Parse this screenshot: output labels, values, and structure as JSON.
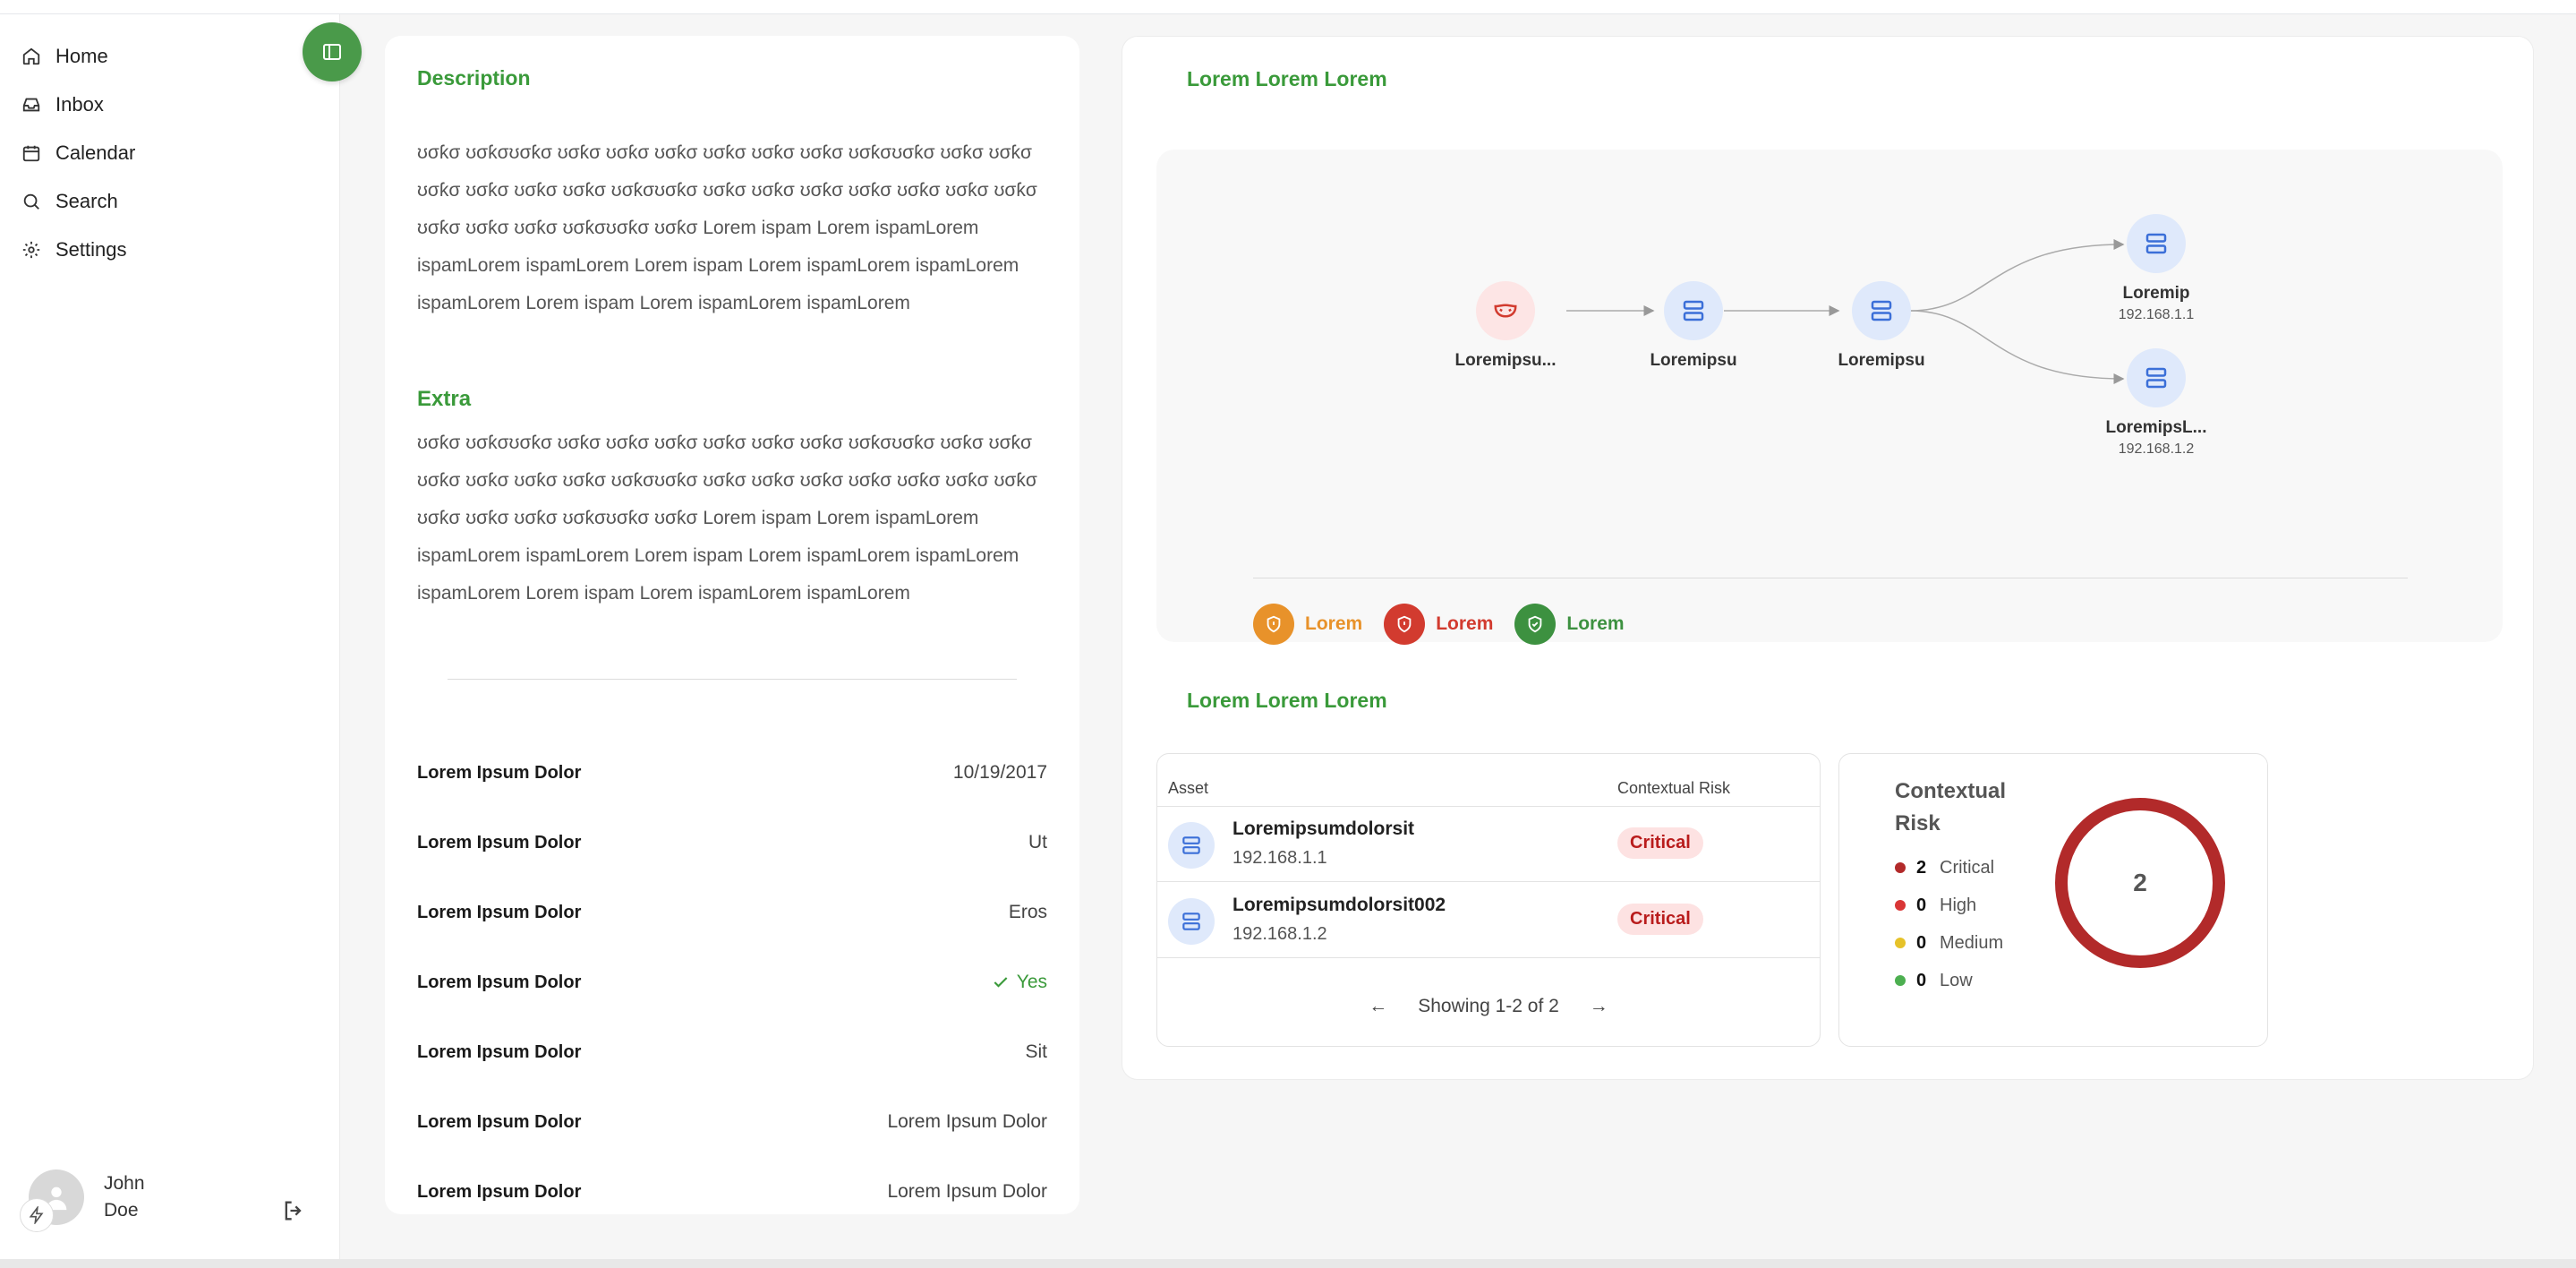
{
  "nav": {
    "items": [
      {
        "label": "Home",
        "icon": "home-icon"
      },
      {
        "label": "Inbox",
        "icon": "inbox-icon"
      },
      {
        "label": "Calendar",
        "icon": "calendar-icon"
      },
      {
        "label": "Search",
        "icon": "search-icon"
      },
      {
        "label": "Settings",
        "icon": "gear-icon"
      }
    ]
  },
  "user": {
    "name": "John Doe"
  },
  "details": {
    "description_title": "Description",
    "description_text": "ʊσƙσ ʊσƙσʊσƙσ ʊσƙσ ʊσƙσ ʊσƙσ ʊσƙσ ʊσƙσ ʊσƙσ ʊσƙσʊσƙσ ʊσƙσ ʊσƙσ ʊσƙσ ʊσƙσ ʊσƙσ ʊσƙσ ʊσƙσʊσƙσ ʊσƙσ ʊσƙσ ʊσƙσ ʊσƙσ ʊσƙσ ʊσƙσ ʊσƙσ ʊσƙσ ʊσƙσ ʊσƙσ ʊσƙσʊσƙσ ʊσƙσ Lorem ispam Lorem ispamLorem ispamLorem ispamLorem Lorem ispam Lorem ispamLorem ispamLorem ispamLorem Lorem ispam Lorem ispamLorem ispamLorem",
    "extra_title": "Extra",
    "extra_text": "ʊσƙσ ʊσƙσʊσƙσ ʊσƙσ ʊσƙσ ʊσƙσ ʊσƙσ ʊσƙσ ʊσƙσ ʊσƙσʊσƙσ ʊσƙσ ʊσƙσ ʊσƙσ ʊσƙσ ʊσƙσ ʊσƙσ ʊσƙσʊσƙσ ʊσƙσ ʊσƙσ ʊσƙσ ʊσƙσ ʊσƙσ ʊσƙσ ʊσƙσ ʊσƙσ ʊσƙσ ʊσƙσ ʊσƙσʊσƙσ ʊσƙσ Lorem ispam Lorem ispamLorem ispamLorem ispamLorem Lorem ispam Lorem ispamLorem ispamLorem ispamLorem Lorem ispam Lorem ispamLorem ispamLorem",
    "props": [
      {
        "key": "Lorem Ipsum Dolor",
        "value": "10/19/2017"
      },
      {
        "key": "Lorem Ipsum Dolor",
        "value": "Ut"
      },
      {
        "key": "Lorem Ipsum Dolor",
        "value": "Eros"
      },
      {
        "key": "Lorem Ipsum Dolor",
        "value": "Yes"
      },
      {
        "key": "Lorem Ipsum Dolor",
        "value": "Sit"
      },
      {
        "key": "Lorem Ipsum Dolor",
        "value": "Lorem Ipsum Dolor"
      },
      {
        "key": "Lorem Ipsum Dolor",
        "value": "Lorem Ipsum Dolor"
      }
    ]
  },
  "graph": {
    "title": "Lorem Lorem Lorem",
    "nodes": [
      {
        "label": "Loremipsu...",
        "ip": ""
      },
      {
        "label": "Loremipsu",
        "ip": ""
      },
      {
        "label": "Loremipsu",
        "ip": ""
      },
      {
        "label": "Loremip",
        "ip": "192.168.1.1"
      },
      {
        "label": "LoremipsL...",
        "ip": "192.168.1.2"
      }
    ],
    "legend": [
      {
        "label": "Lorem",
        "color": "#e8922a"
      },
      {
        "label": "Lorem",
        "color": "#d23b2f"
      },
      {
        "label": "Lorem",
        "color": "#3d9140"
      }
    ]
  },
  "assets": {
    "title": "Lorem Lorem Lorem",
    "headers": {
      "asset": "Asset",
      "risk": "Contextual Risk"
    },
    "rows": [
      {
        "name": "Loremipsumdolorsit",
        "ip": "192.168.1.1",
        "risk": "Critical"
      },
      {
        "name": "Loremipsumdolorsit002",
        "ip": "192.168.1.2",
        "risk": "Critical"
      }
    ],
    "pager_text": "Showing 1-2 of 2"
  },
  "risk_summary": {
    "title": "Contextual Risk",
    "total": "2",
    "items": [
      {
        "label": "Critical",
        "count": "2",
        "color": "#b22a2a"
      },
      {
        "label": "High",
        "count": "0",
        "color": "#d93636"
      },
      {
        "label": "Medium",
        "count": "0",
        "color": "#e6c229"
      },
      {
        "label": "Low",
        "count": "0",
        "color": "#4caf50"
      }
    ]
  }
}
